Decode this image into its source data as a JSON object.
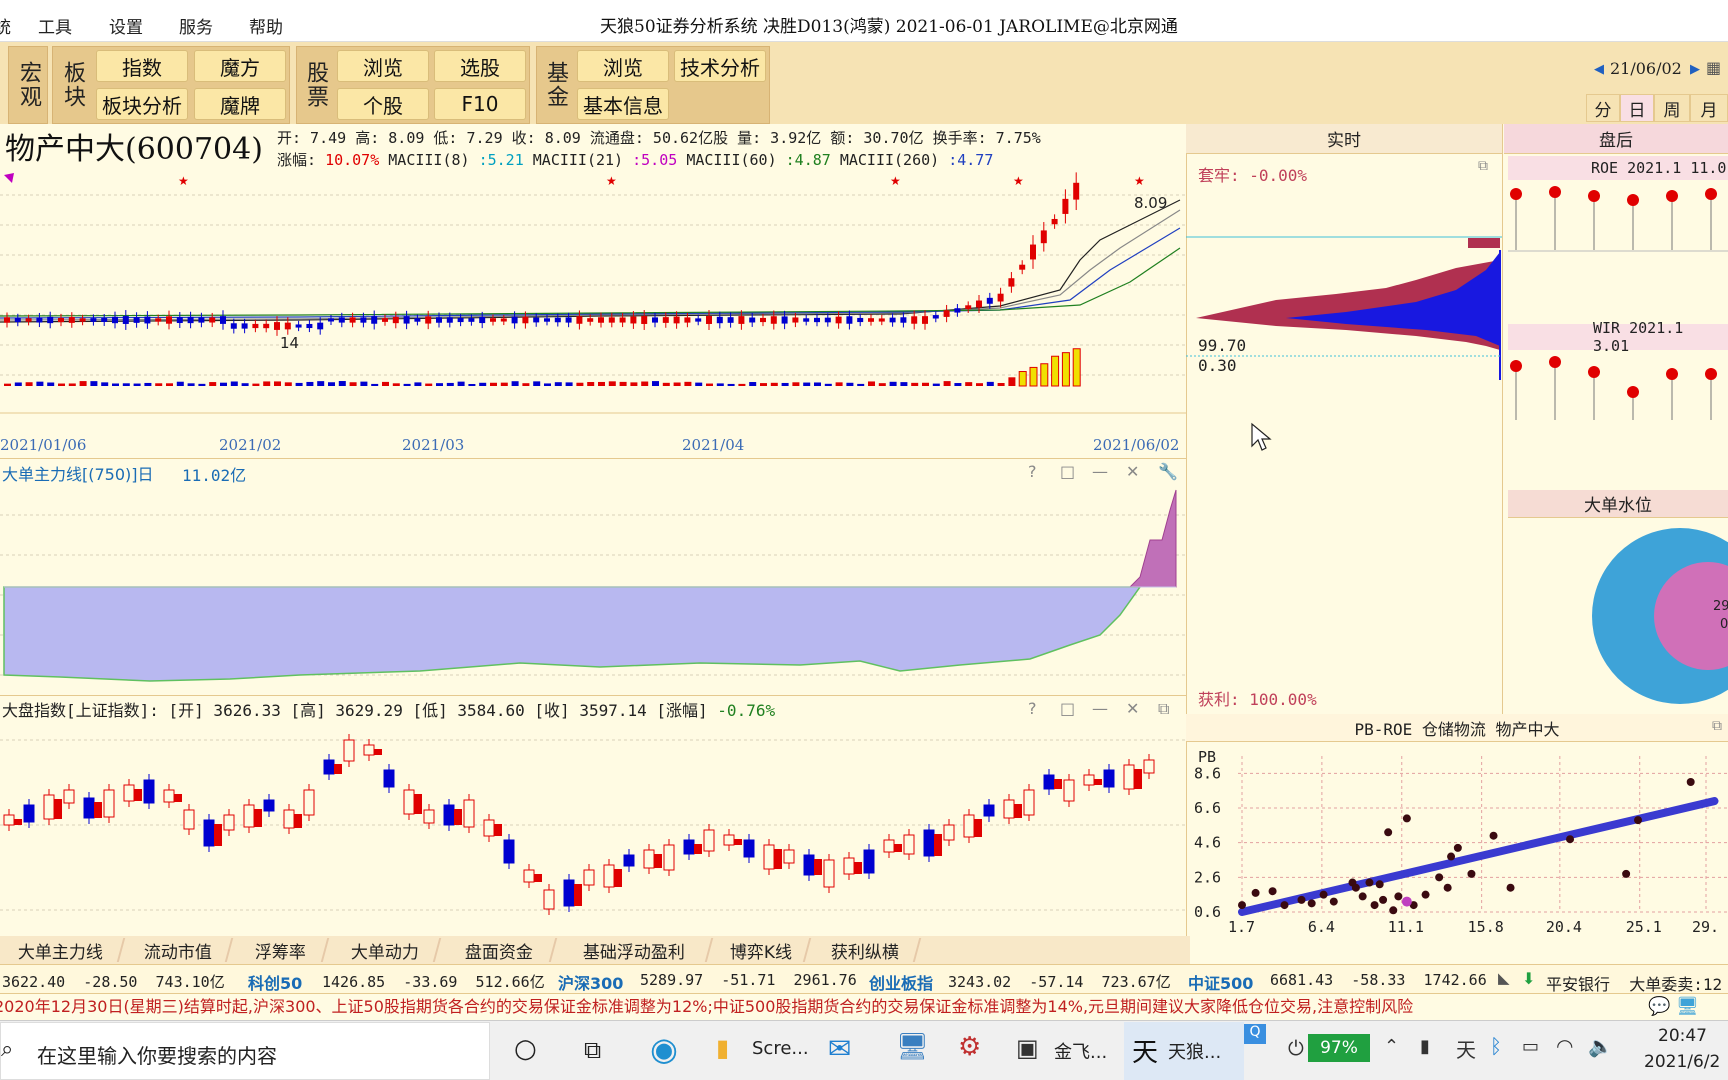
{
  "window": {
    "title": "天狼50证券分析系统  决胜D013(鸿蒙)  2021-06-01 JAROLIME@北京网通",
    "menu": [
      "统",
      "工具",
      "设置",
      "服务",
      "帮助"
    ]
  },
  "toolbar": {
    "groups": [
      {
        "label": "宏观",
        "buttons": []
      },
      {
        "label": "板块",
        "buttons": [
          "指数",
          "魔方",
          "板块分析",
          "魔牌"
        ]
      },
      {
        "label": "股票",
        "buttons": [
          "浏览",
          "选股",
          "个股",
          "F10"
        ]
      },
      {
        "label": "基金",
        "buttons": [
          "浏览",
          "技术分析",
          "基本信息"
        ]
      }
    ],
    "date_nav": "21/06/02",
    "period_tabs": [
      "分",
      "日",
      "周",
      "月"
    ],
    "active_period": "日"
  },
  "stock": {
    "name": "物产中大(600704)",
    "line1": "开: 7.49 高: 8.09 低: 7.29 收: 8.09 流通盘: 50.62亿股 量: 3.92亿 额: 30.70亿 换手率: 7.75%",
    "line2_prefix": "涨幅: ",
    "change_pct": "10.07%",
    "macd": [
      {
        "label": "MACIII(8)",
        "value": ":5.21"
      },
      {
        "label": "MACIII(21)",
        "value": ":5.05"
      },
      {
        "label": "MACIII(60)",
        "value": ":4.87"
      },
      {
        "label": "MACIII(260)",
        "value": ":4.77"
      }
    ]
  },
  "kline": {
    "high_label": "8.09",
    "low_label": "14",
    "x_ticks": [
      "2021/01/06",
      "2021/02",
      "2021/03",
      "2021/04",
      "2021/06/02"
    ]
  },
  "mainforce": {
    "title": "大单主力线[(750)]日",
    "value": "11.02亿"
  },
  "index_panel": {
    "title": "大盘指数[上证指数]: [开] 3626.33 [高] 3629.29 [低] 3584.60 [收] 3597.14 [涨幅]",
    "change": "-0.76%"
  },
  "realtime": {
    "header": "实时",
    "trapped": "套牢: -0.00%",
    "price_top": "99.70",
    "price_bottom": "0.30",
    "profit": "获利: 100.00%"
  },
  "after_hours": {
    "header": "盘后",
    "roe_label": "ROE 2021.1 11.0",
    "wir_label": "WIR 2021.1 3.01",
    "water_title": "大单水位",
    "water_text": [
      "29",
      "0"
    ]
  },
  "pbroe": {
    "title": "PB-ROE 仓储物流  物产中大",
    "ylabel": "PB",
    "y_ticks": [
      "8.6",
      "6.6",
      "4.6",
      "2.6",
      "0.6"
    ],
    "x_ticks": [
      "1.7",
      "6.4",
      "11.1",
      "15.8",
      "20.4",
      "25.1",
      "29."
    ]
  },
  "chart_data": {
    "type": "scatter",
    "title": "PB-ROE 仓储物流  物产中大",
    "xlabel": "",
    "ylabel": "PB",
    "xlim": [
      1.7,
      29.0
    ],
    "ylim": [
      0.6,
      9.6
    ],
    "x": [
      1.7,
      2.5,
      3.5,
      4.2,
      5.2,
      5.8,
      6.5,
      7.1,
      8.2,
      8.4,
      8.8,
      9.2,
      9.5,
      9.8,
      10.0,
      10.3,
      10.6,
      10.9,
      11.4,
      11.8,
      12.5,
      13.3,
      13.8,
      14.0,
      14.4,
      15.2,
      16.5,
      17.5,
      21.0,
      24.3,
      25.0,
      28.1
    ],
    "y": [
      1.0,
      1.7,
      1.8,
      1.0,
      1.3,
      1.1,
      1.6,
      1.2,
      2.3,
      2.0,
      1.5,
      2.3,
      1.0,
      2.2,
      1.3,
      5.2,
      0.7,
      1.5,
      6.0,
      1.0,
      1.6,
      2.6,
      2.0,
      3.8,
      4.3,
      2.8,
      5.0,
      2.0,
      4.8,
      2.8,
      5.9,
      8.1
    ],
    "trend": {
      "x": [
        1.7,
        29.5
      ],
      "y": [
        0.6,
        7.0
      ]
    }
  },
  "bottom_tabs": [
    "大单主力线",
    "流动市值",
    "浮筹率",
    "大单动力",
    "盘面资金",
    "基础浮动盈利",
    "博弈K线",
    "获利纵横"
  ],
  "quotes": {
    "q0": "3622.40  -28.50  743.10亿",
    "i1": "科创50",
    "q1": "1426.85  -33.69  512.66亿",
    "i2": "沪深300",
    "q2": "5289.97  -51.71  2961.76",
    "i3": "创业板指",
    "q3": "3243.02  -57.14  723.67亿",
    "i4": "中证500",
    "q4": "6681.43  -58.33  1742.66",
    "right": "平安银行  大单委卖:12"
  },
  "notice": "2020年12月30日(星期三)结算时起,沪深300、上证50股指期货各合约的交易保证金标准调整为12%;中证500股指期货合约的交易保证金标准调整为14%,元旦期间建议大家降低仓位交易,注意控制风险",
  "taskbar": {
    "search_placeholder": "在这里输入你要搜索的内容",
    "apps": [
      "Scre...",
      "金飞...",
      "天狼..."
    ],
    "battery": "97%",
    "time": "20:47",
    "date": "2021/6/2"
  },
  "colors": {
    "up": "#e00000",
    "down": "#0000d0",
    "background": "#fffbe3"
  }
}
